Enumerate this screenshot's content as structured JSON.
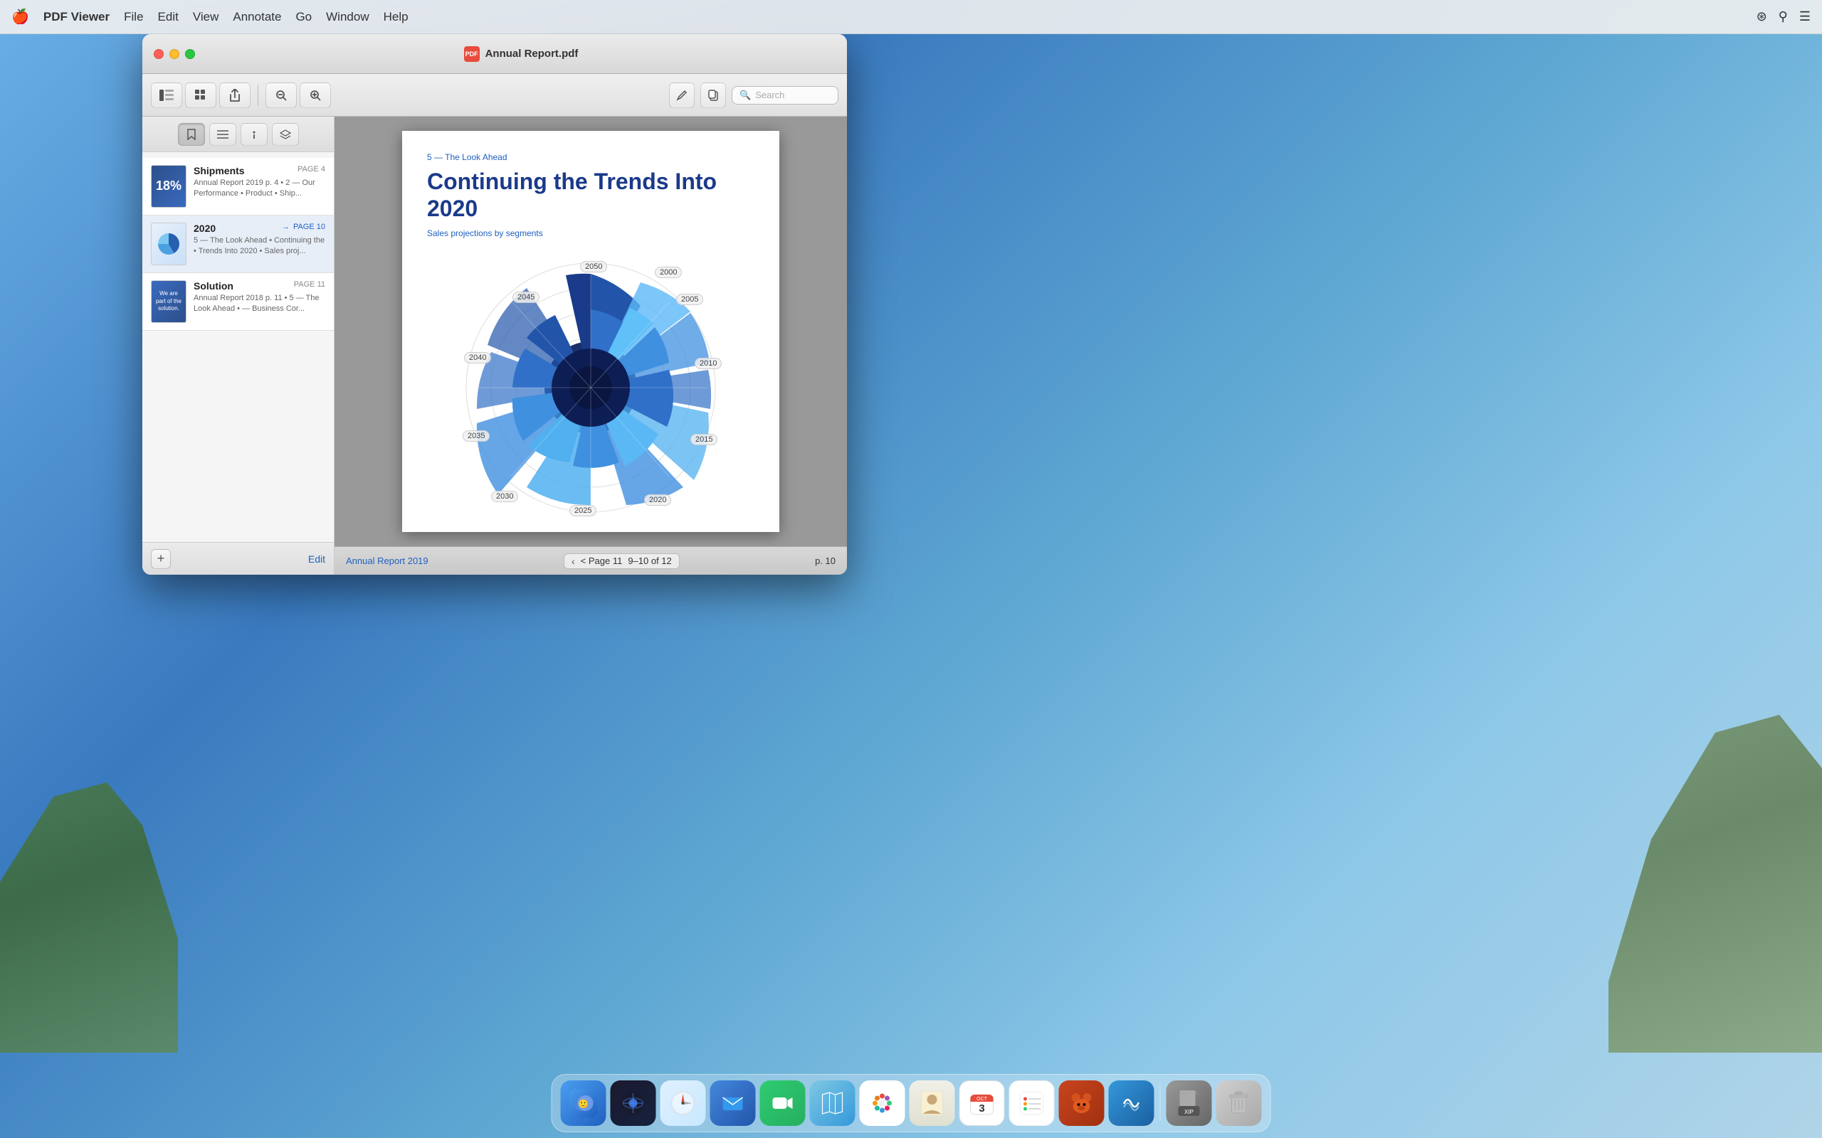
{
  "menubar": {
    "apple": "🍎",
    "app_name": "PDF Viewer",
    "menus": [
      "File",
      "Edit",
      "View",
      "Annotate",
      "Go",
      "Window",
      "Help"
    ],
    "right_icons": [
      "wifi",
      "search",
      "menu"
    ]
  },
  "window": {
    "title": "Annual Report.pdf",
    "toolbar": {
      "buttons": [
        "sidebar_toggle",
        "grid_view",
        "share",
        "zoom_out",
        "zoom_in"
      ],
      "search_placeholder": "Search"
    }
  },
  "sidebar": {
    "tabs": [
      "bookmark",
      "list",
      "info",
      "layers"
    ],
    "results": [
      {
        "title": "Shipments",
        "page_label": "PAGE 4",
        "page_type": "normal",
        "description": "Annual Report 2019 p. 4 • 2 — Our Performance • Product • Ship..."
      },
      {
        "title": "2020",
        "page_label": "PAGE 10",
        "page_type": "blue",
        "description": "5 — The Look Ahead • Continuing the • Trends Into 2020 • Sales proj..."
      },
      {
        "title": "Solution",
        "page_label": "PAGE 11",
        "page_type": "normal",
        "description": "Annual Report 2018 p. 11 • 5 — The Look Ahead • — Business Cor..."
      }
    ],
    "add_button": "+",
    "edit_button": "Edit"
  },
  "pdf": {
    "section_label": "5 — The Look Ahead",
    "main_title": "Continuing the Trends Into 2020",
    "subtitle": "Sales projections by segments",
    "chart_labels": [
      "2050",
      "2045",
      "2040",
      "2035",
      "2030",
      "2025",
      "2020",
      "2015",
      "2010",
      "2005",
      "2000"
    ],
    "footer_left": "Annual Report 2019",
    "footer_page": "9–10 of 12",
    "footer_right": "p. 10",
    "page_nav": "< Page 11"
  },
  "dock": {
    "items": [
      "Finder",
      "Launchpad",
      "Safari",
      "Mail",
      "FaceTime",
      "Maps",
      "Photos",
      "Contacts",
      "Calendar",
      "Reminders",
      "Bear",
      "Airflow",
      "Xip",
      "Trash"
    ]
  }
}
